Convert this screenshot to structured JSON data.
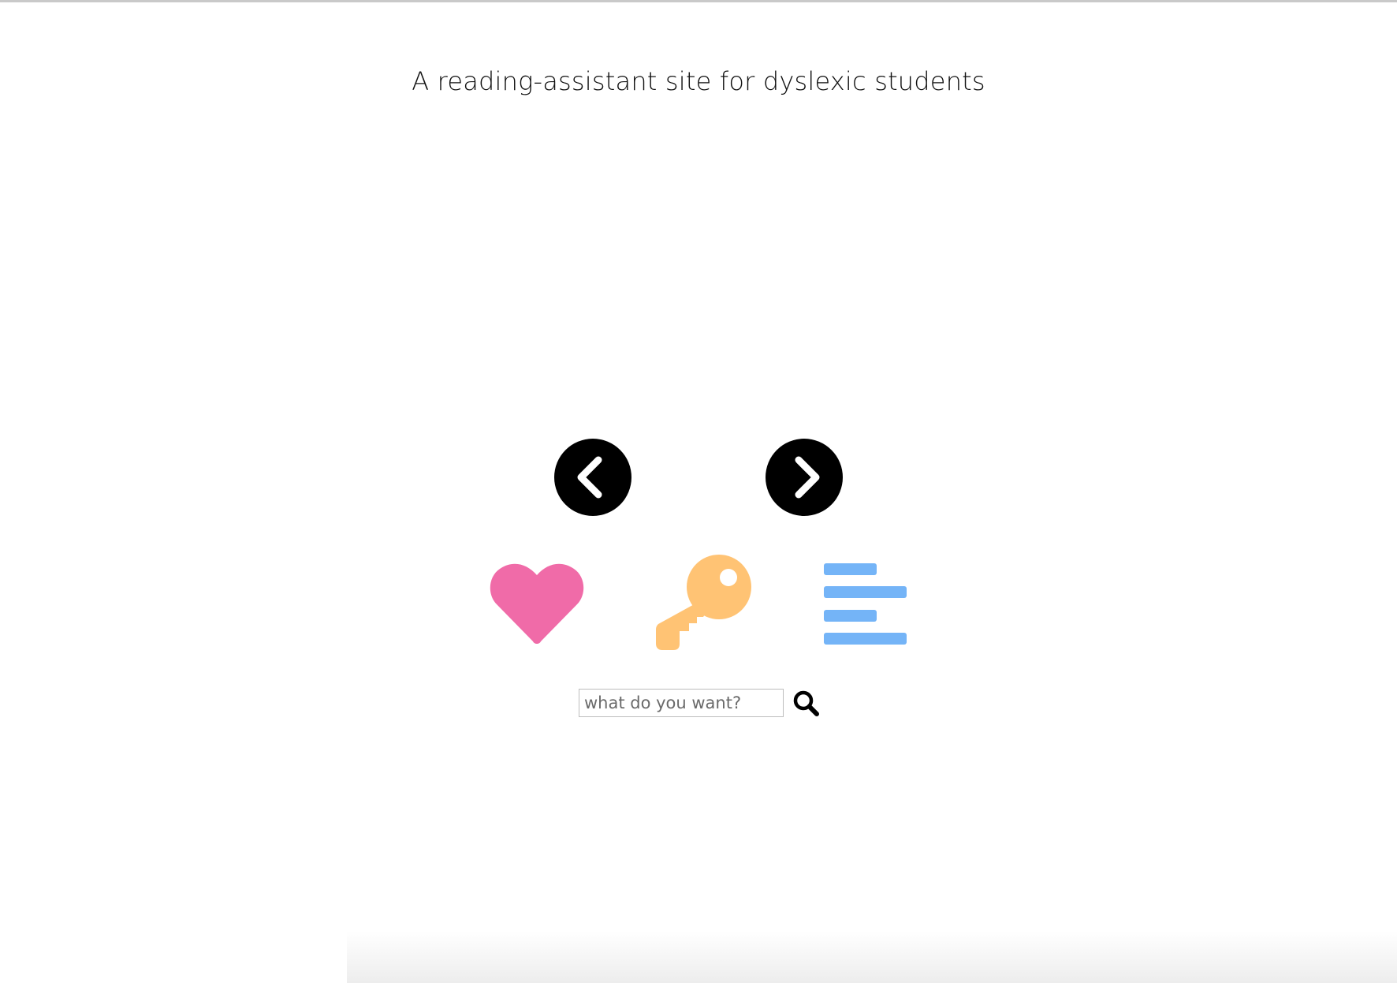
{
  "header": {
    "tagline": "A reading-assistant site for dyslexic students"
  },
  "navigation": {
    "prev_icon": "chevron-left-icon",
    "next_icon": "chevron-right-icon"
  },
  "features": [
    {
      "icon": "heart-icon",
      "color": "#F06BA8"
    },
    {
      "icon": "key-icon",
      "color": "#FFC374"
    },
    {
      "icon": "align-left-icon",
      "color": "#74B4F7"
    }
  ],
  "search": {
    "placeholder": "what do you want?",
    "value": "",
    "icon": "search-icon"
  },
  "colors": {
    "background": "#FFFFFF",
    "text": "#111111",
    "nav_button": "#000000"
  }
}
